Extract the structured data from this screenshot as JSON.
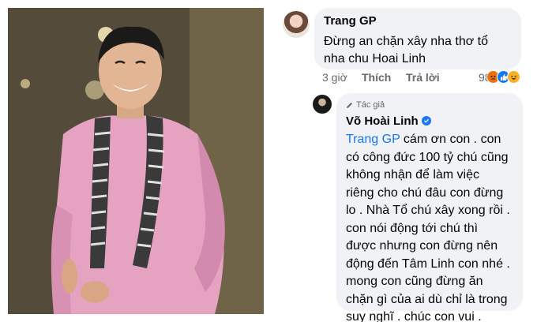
{
  "comment": {
    "author": "Trang GP",
    "text_line1": "Đừng an chặn xây nha thơ tổ",
    "text_line2": "nha chu Hoai Linh",
    "time": "3 giờ",
    "like_label": "Thích",
    "reply_label": "Trả lời",
    "reaction_count": "98",
    "reaction_icons": [
      "angry-icon",
      "like-icon",
      "haha-icon"
    ]
  },
  "reply": {
    "author_badge": "Tác giả",
    "author": "Võ Hoài Linh",
    "mention": "Trang GP",
    "lines": [
      " cám ơn con . con",
      "có công đức 100 tỷ chú cũng",
      "không nhận để làm việc",
      "riêng cho chú đâu con đừng",
      "lo . Nhà Tổ chú xây xong rồi .",
      "con nói động tới chú thì",
      "được nhưng con đừng nên",
      "động đến Tâm Linh con nhé .",
      "mong con cũng đừng ăn",
      "chặn gì của ai dù chỉ là trong",
      "suy nghĩ . chúc con vui ."
    ]
  },
  "colors": {
    "bubble": "#f0f2f5",
    "link": "#1877f2",
    "meta": "#65676b",
    "shirt": "#e5a3c1"
  }
}
